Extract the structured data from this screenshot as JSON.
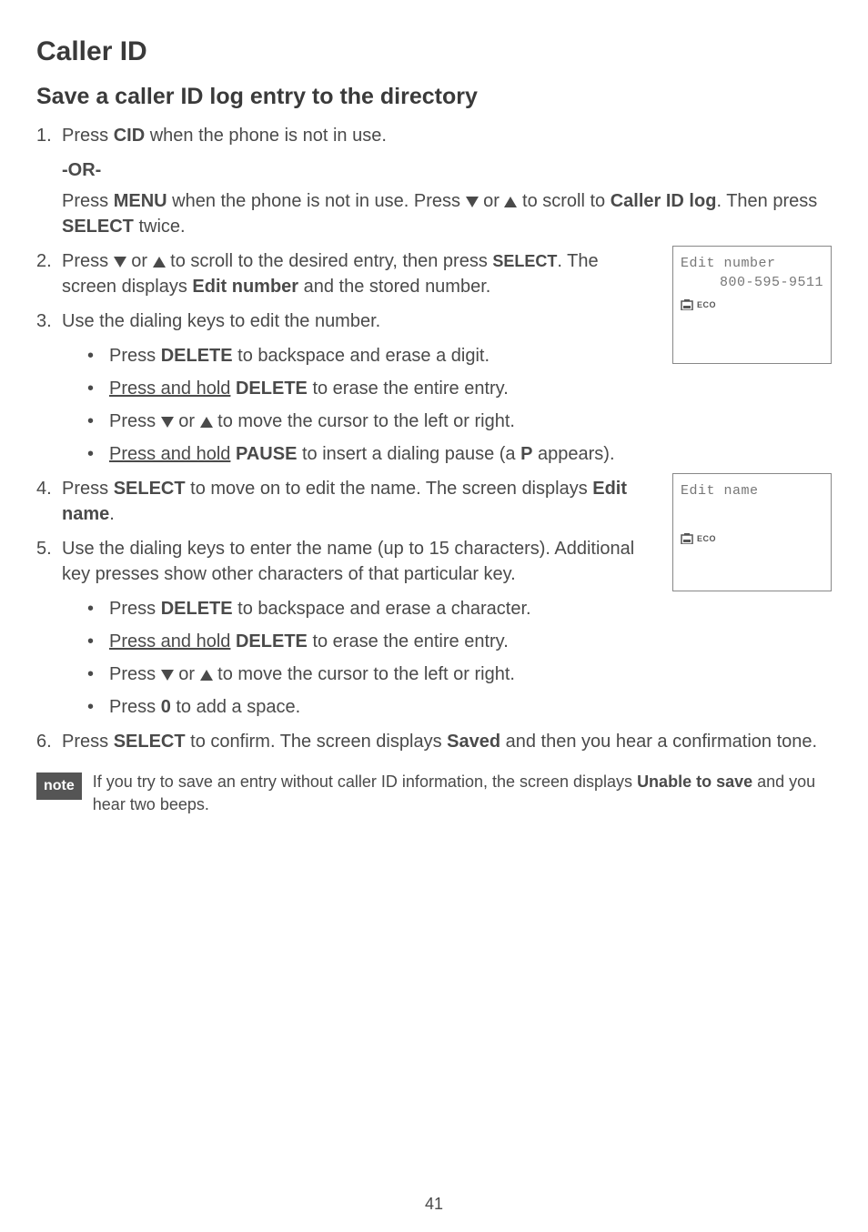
{
  "title": "Caller ID",
  "section": "Save a caller ID log entry to the directory",
  "step1": {
    "num": "1.",
    "text_a": "Press ",
    "text_b": "CID",
    "text_c": " when the phone is not in use.",
    "or": "-OR-",
    "text_d": "Press ",
    "text_e": "MENU",
    "text_f": " when the phone is not in use. Press ",
    "text_g": " or ",
    "text_h": " to scroll to ",
    "text_i": "Caller ID log",
    "text_j": ". Then press ",
    "text_k": "SELECT",
    "text_l": " twice."
  },
  "step2": {
    "num": "2.",
    "text_a": "Press ",
    "text_b": " or ",
    "text_c": " to scroll to the desired entry, then press ",
    "text_d": "SELECT",
    "text_e": ". The screen displays ",
    "text_f": "Edit number",
    "text_g": " and the stored number."
  },
  "step3": {
    "num": "3.",
    "text_a": "Use the dialing keys to edit the number.",
    "b1_a": "Press ",
    "b1_b": "DELETE",
    "b1_c": " to backspace and erase a digit.",
    "b2_a": "Press and hold",
    "b2_b": " ",
    "b2_c": "DELETE",
    "b2_d": " to erase the entire entry.",
    "b3_a": "Press ",
    "b3_b": " or ",
    "b3_c": " to move the cursor to the left or right.",
    "b4_a": "Press and hold",
    "b4_b": " ",
    "b4_c": "PAUSE",
    "b4_d": " to insert a dialing pause (a ",
    "b4_e": "P",
    "b4_f": " appears)."
  },
  "step4": {
    "num": "4.",
    "text_a": "Press ",
    "text_b": "SELECT",
    "text_c": " to move on to edit the name. The screen displays ",
    "text_d": "Edit name",
    "text_e": "."
  },
  "step5": {
    "num": "5.",
    "text_a": "Use the dialing keys to enter the name (up to 15 characters). Additional key presses show other characters of that particular key.",
    "b1_a": "Press ",
    "b1_b": "DELETE",
    "b1_c": " to backspace and erase a character.",
    "b2_a": "Press and hold",
    "b2_b": " ",
    "b2_c": "DELETE",
    "b2_d": " to erase the entire entry.",
    "b3_a": "Press ",
    "b3_b": " or ",
    "b3_c": " to move the cursor to the left or right.",
    "b4_a": "Press ",
    "b4_b": "0",
    "b4_c": " to add a space."
  },
  "step6": {
    "num": "6.",
    "text_a": "Press ",
    "text_b": "SELECT",
    "text_c": " to confirm. The screen displays ",
    "text_d": "Saved",
    "text_e": " and then you hear a confirmation tone."
  },
  "note": {
    "badge": "note",
    "text_a": "If you try to save an entry without caller ID information, the screen displays ",
    "text_b": "Unable to save",
    "text_c": " and you hear two beeps."
  },
  "screen1": {
    "line1": "Edit number",
    "line2": "800-595-9511",
    "eco": "ECO"
  },
  "screen2": {
    "line1": "Edit name",
    "eco": "ECO"
  },
  "page_num": "41"
}
